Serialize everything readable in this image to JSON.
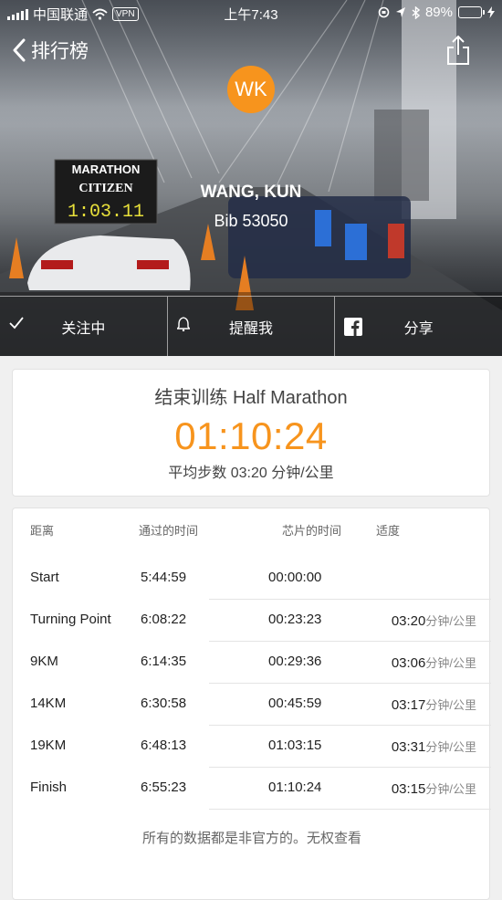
{
  "status_bar": {
    "carrier": "中国联通",
    "vpn": "VPN",
    "time": "上午7:43",
    "battery": "89%",
    "battery_level": 0.89
  },
  "nav": {
    "back_label": "排行榜"
  },
  "runner": {
    "initials": "WK",
    "name": "WANG, KUN",
    "bib": "Bib 53050"
  },
  "actions": [
    {
      "label": "关注中",
      "icon": "checkmark-icon"
    },
    {
      "label": "提醒我",
      "icon": "bell-icon"
    },
    {
      "label": "分享",
      "icon": "facebook-icon"
    }
  ],
  "summary": {
    "title": "结束训练 Half Marathon",
    "total_time": "01:10:24",
    "pace": "平均步数 03:20 分钟/公里"
  },
  "splits": {
    "headers": {
      "distance": "距离",
      "pass_time": "通过的时间",
      "chip_time": "芯片的时间",
      "pace": "适度"
    },
    "pace_unit": "分钟/公里",
    "rows": [
      {
        "distance": "Start",
        "pass_time": "5:44:59",
        "chip_time": "00:00:00",
        "pace": ""
      },
      {
        "distance": "Turning Point",
        "pass_time": "6:08:22",
        "chip_time": "00:23:23",
        "pace": "03:20"
      },
      {
        "distance": "9KM",
        "pass_time": "6:14:35",
        "chip_time": "00:29:36",
        "pace": "03:06"
      },
      {
        "distance": "14KM",
        "pass_time": "6:30:58",
        "chip_time": "00:45:59",
        "pace": "03:17"
      },
      {
        "distance": "19KM",
        "pass_time": "6:48:13",
        "chip_time": "01:03:15",
        "pace": "03:31"
      },
      {
        "distance": "Finish",
        "pass_time": "6:55:23",
        "chip_time": "01:10:24",
        "pace": "03:15"
      }
    ],
    "note": "所有的数据都是非官方的。无权查看"
  },
  "hero_signage": {
    "board_title": "MARATHON",
    "board_brand": "CITIZEN",
    "board_clock": "1:03.11"
  },
  "colors": {
    "accent": "#f7941d",
    "battery": "#4cd964"
  }
}
